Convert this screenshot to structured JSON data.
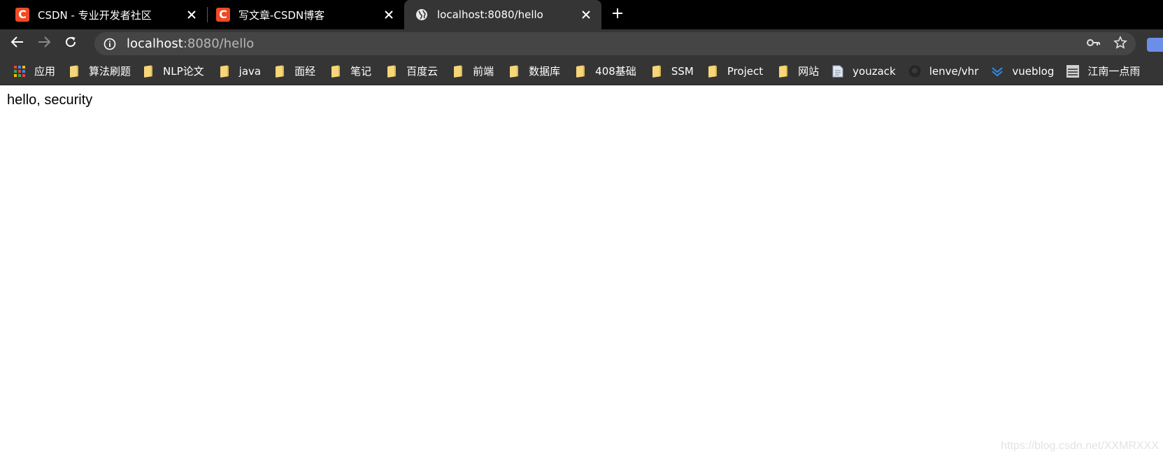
{
  "tabs": [
    {
      "favicon": "csdn-icon",
      "favicon_glyph": "C",
      "title": "CSDN - 专业开发者社区",
      "active": false
    },
    {
      "favicon": "csdn-icon",
      "favicon_glyph": "C",
      "title": "写文章-CSDN博客",
      "active": false
    },
    {
      "favicon": "globe-icon",
      "title": "localhost:8080/hello",
      "active": true
    }
  ],
  "address_bar": {
    "host": "localhost",
    "rest": ":8080/hello"
  },
  "bookmarks": [
    {
      "icon": "apps-grid-icon",
      "label": "应用"
    },
    {
      "icon": "folder-icon",
      "label": "算法刷题"
    },
    {
      "icon": "folder-icon",
      "label": "NLP论文"
    },
    {
      "icon": "folder-icon",
      "label": "java"
    },
    {
      "icon": "folder-icon",
      "label": "面经"
    },
    {
      "icon": "folder-icon",
      "label": "笔记"
    },
    {
      "icon": "folder-icon",
      "label": "百度云"
    },
    {
      "icon": "folder-icon",
      "label": "前端"
    },
    {
      "icon": "folder-icon",
      "label": "数据库"
    },
    {
      "icon": "folder-icon",
      "label": "408基础"
    },
    {
      "icon": "folder-icon",
      "label": "SSM"
    },
    {
      "icon": "folder-icon",
      "label": "Project"
    },
    {
      "icon": "folder-icon",
      "label": "网站"
    },
    {
      "icon": "document-icon",
      "label": "youzack"
    },
    {
      "icon": "github-icon",
      "label": "lenve/vhr"
    },
    {
      "icon": "vueblog-icon",
      "label": "vueblog"
    },
    {
      "icon": "image-icon",
      "label": "江南一点雨"
    }
  ],
  "page": {
    "text": "hello, security"
  },
  "watermark": "https://blog.csdn.net/XXMRXXX",
  "colors": {
    "tabstrip_bg": "#000000",
    "toolbar_bg": "#353535",
    "omnibox_bg": "#454545",
    "csdn_brand": "#f04a25",
    "folder": "#f6d679"
  }
}
